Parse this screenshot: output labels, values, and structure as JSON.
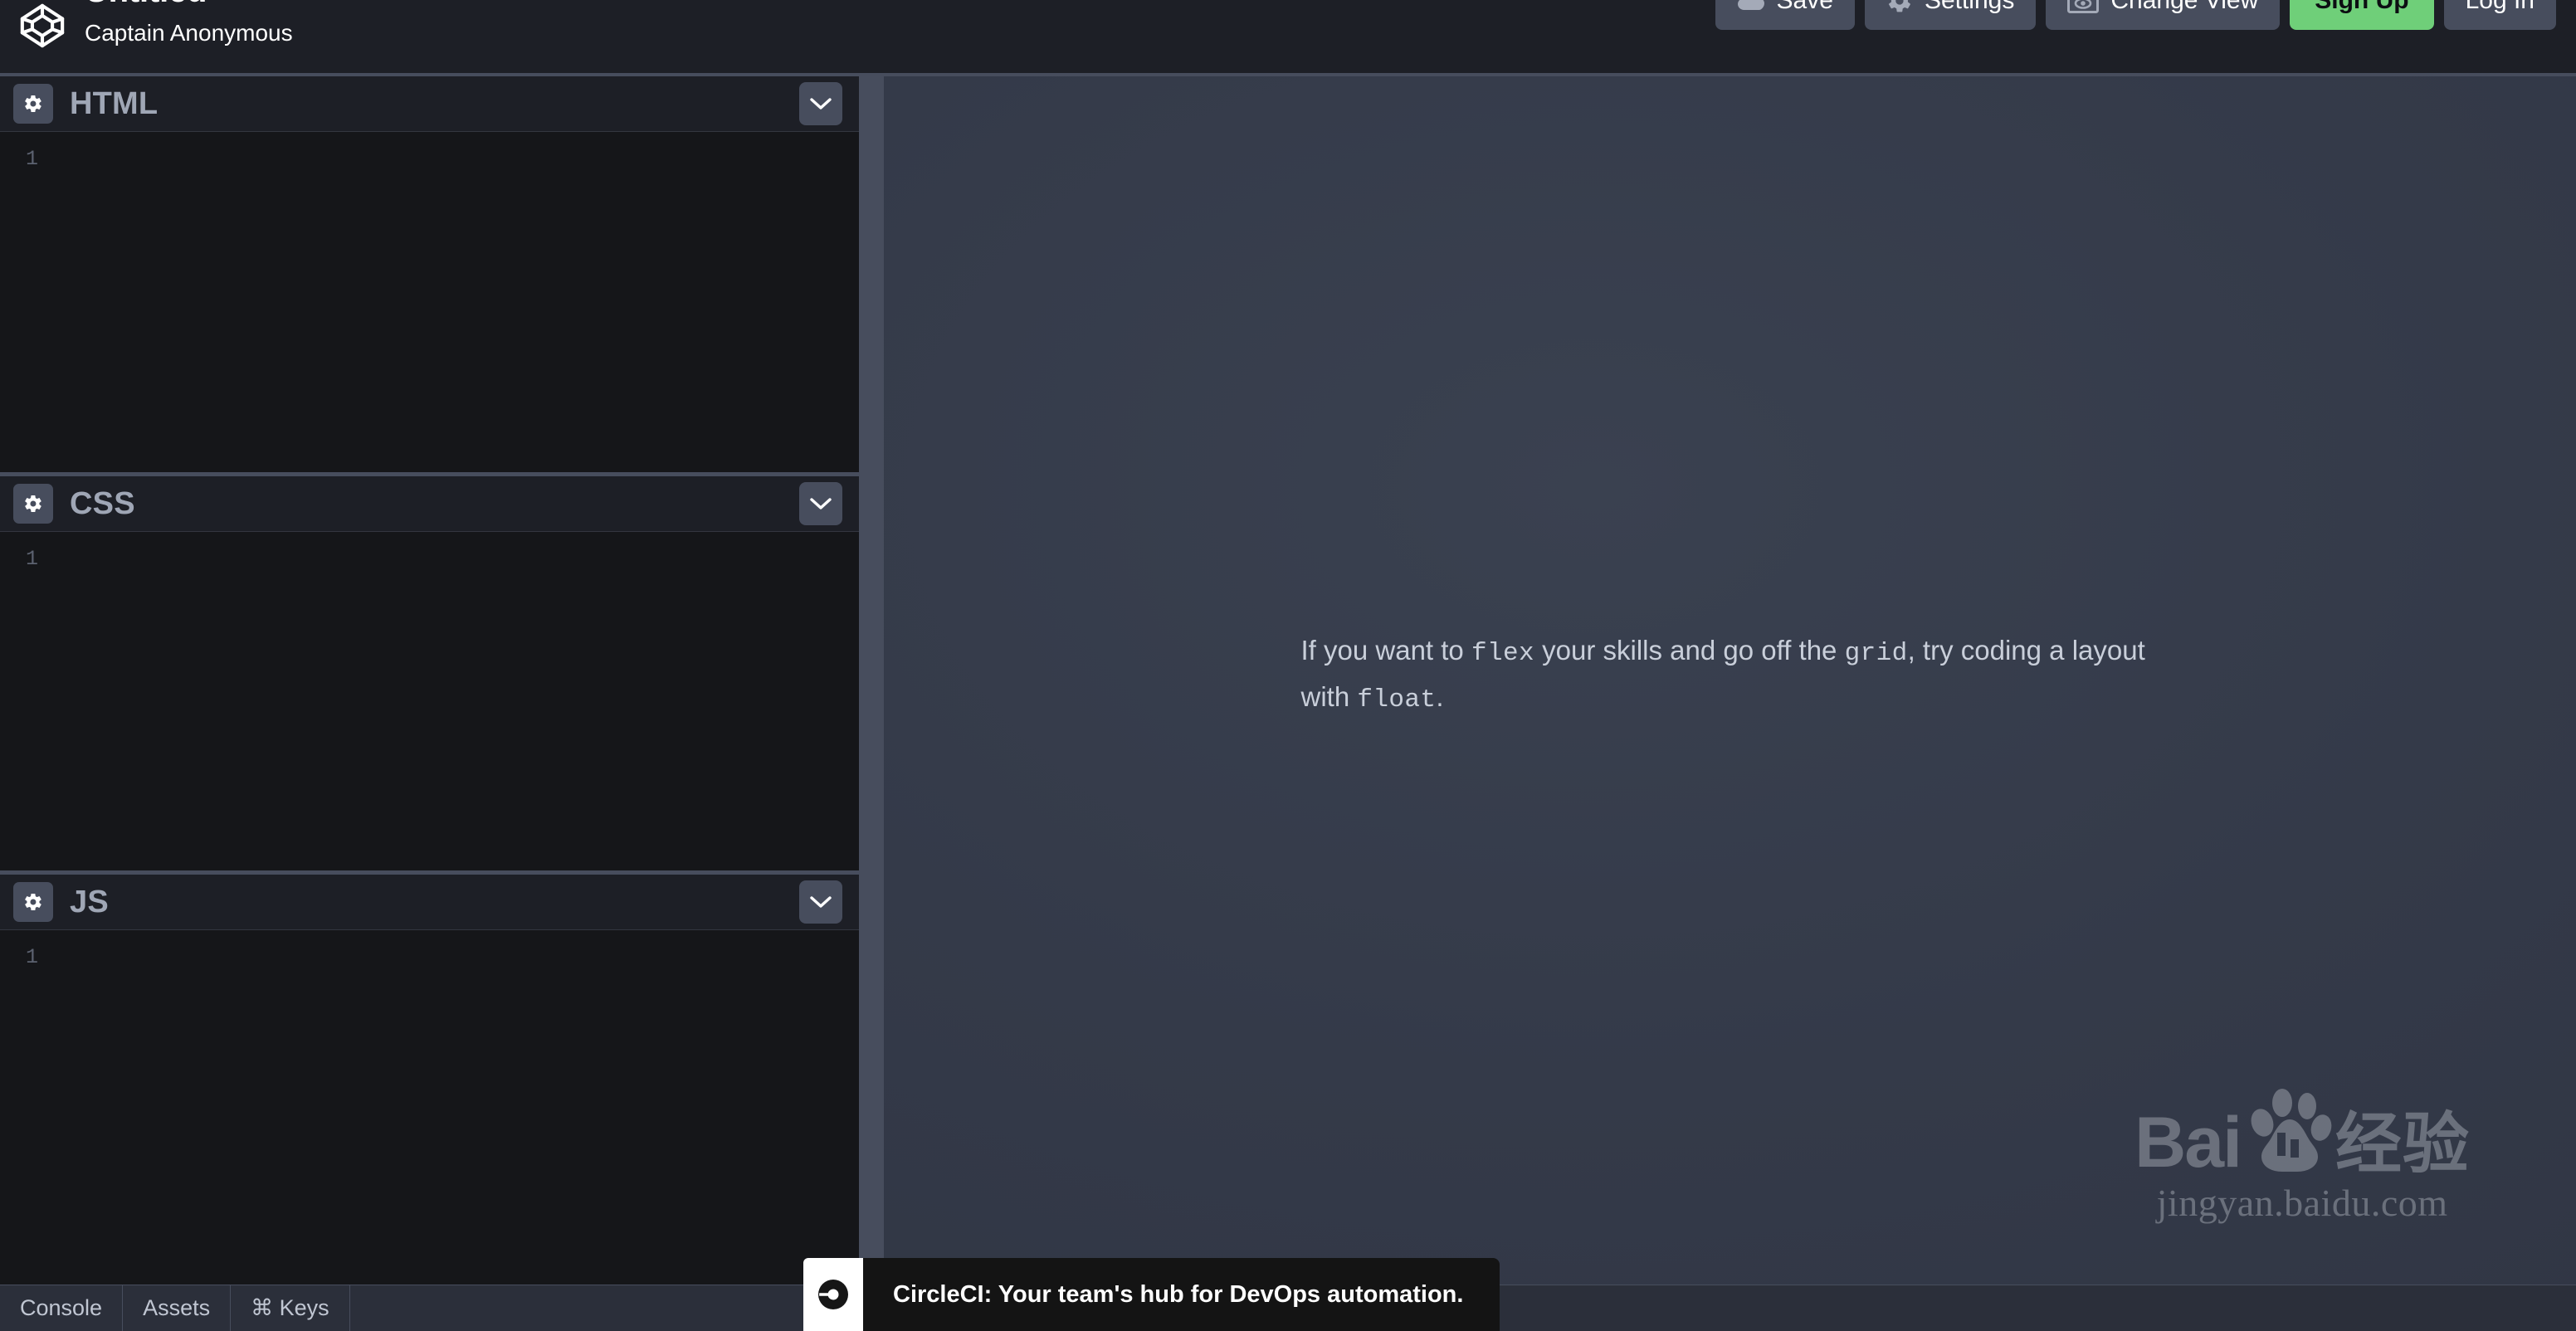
{
  "header": {
    "logo_icon": "codepen-logo-icon",
    "pen_title": "Untitled",
    "title_caret": "›",
    "author": "Captain Anonymous",
    "actions": [
      {
        "label": "Save",
        "icon": "cloud-icon",
        "style": "default"
      },
      {
        "label": "Settings",
        "icon": "gear-icon",
        "style": "default"
      },
      {
        "label": "Change View",
        "icon": "screen-eye-icon",
        "style": "default"
      },
      {
        "label": "Sign Up",
        "icon": "",
        "style": "accent"
      },
      {
        "label": "Log In",
        "icon": "",
        "style": "default"
      }
    ]
  },
  "editors": [
    {
      "id": "html",
      "title": "HTML",
      "settings_icon": "gear-icon",
      "collapse_icon": "chevron-down-icon",
      "line_number": "1",
      "code": ""
    },
    {
      "id": "css",
      "title": "CSS",
      "settings_icon": "gear-icon",
      "collapse_icon": "chevron-down-icon",
      "line_number": "1",
      "code": ""
    },
    {
      "id": "js",
      "title": "JS",
      "settings_icon": "gear-icon",
      "collapse_icon": "chevron-down-icon",
      "line_number": "1",
      "code": ""
    }
  ],
  "preview": {
    "tip": {
      "part1": "If you want to ",
      "code1": "flex",
      "part2": " your skills and go off the ",
      "code2": "grid",
      "part3": ", try coding a layout with ",
      "code3": "float",
      "part4": "."
    },
    "watermark": {
      "brand_latin": "Bai",
      "brand_paw_icon": "baidu-paw-icon",
      "brand_cn": "经验",
      "url": "jingyan.baidu.com"
    }
  },
  "footer": {
    "tabs": [
      {
        "label": "Console"
      },
      {
        "label": "Assets"
      },
      {
        "label": "⌘ Keys"
      }
    ]
  },
  "ad": {
    "logo_icon": "circleci-logo-icon",
    "text": "CircleCI: Your team's hub for DevOps automation.",
    "close_icon": "close-icon"
  },
  "colors": {
    "app_bg": "#1D1F26",
    "editor_bg": "#151619",
    "chrome_gray": "#474D5D",
    "accent_green": "#6FCF79",
    "preview_bg": "#353B4A",
    "text_muted": "#9FA6B5",
    "footer_bg": "#2B2F3A",
    "ad_bg": "#141414"
  }
}
